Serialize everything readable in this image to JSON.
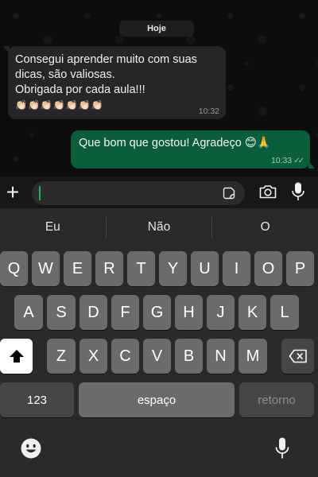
{
  "chat": {
    "date_label": "Hoje",
    "incoming": {
      "lines": [
        "Consegui aprender muito com suas",
        "dicas, são valiosas.",
        "Obrigada por cada aula!!!"
      ],
      "emojis": "👏🏻👏🏻👏🏻👏🏻👏🏻👏🏻👏🏻",
      "time": "10:32"
    },
    "outgoing": {
      "text": "Que bom que gostou! Agradeço 😊🙏",
      "time": "10:33",
      "ticks": "✓✓"
    }
  },
  "composer": {
    "plus_label": "+",
    "value": ""
  },
  "suggestions": [
    "Eu",
    "Não",
    "O"
  ],
  "keyboard": {
    "row1": [
      "Q",
      "W",
      "E",
      "R",
      "T",
      "Y",
      "U",
      "I",
      "O",
      "P"
    ],
    "row2": [
      "A",
      "S",
      "D",
      "F",
      "G",
      "H",
      "J",
      "K",
      "L"
    ],
    "row3": [
      "Z",
      "X",
      "C",
      "V",
      "B",
      "N",
      "M"
    ],
    "numbers_label": "123",
    "space_label": "espaço",
    "return_label": "retorno"
  },
  "colors": {
    "outgoing_bubble": "#0b5e3a",
    "incoming_bubble": "#262626",
    "caret": "#1fb35a",
    "key": "#6b6b6b"
  }
}
